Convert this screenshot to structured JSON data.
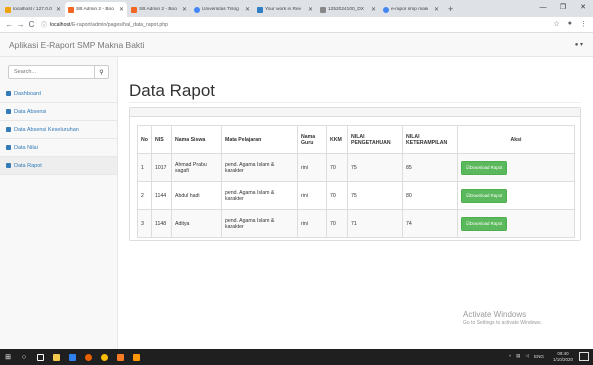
{
  "browser": {
    "tabs": [
      {
        "label": "localhost / 127.0.0",
        "color": "#f0a30a",
        "active": false
      },
      {
        "label": "SB Admin 2 - Boo",
        "color": "#f26522",
        "active": true
      },
      {
        "label": "SB Admin 2 - Boo",
        "color": "#f26522",
        "active": false
      },
      {
        "label": "Universitas Trilog",
        "color": "#4285f4",
        "active": false
      },
      {
        "label": "Your work in Rev",
        "color": "#2f7dc3",
        "active": false
      },
      {
        "label": "1252024100_DX",
        "color": "#888888",
        "active": false
      },
      {
        "label": "e-rapor smp maki",
        "color": "#4285f4",
        "active": false
      }
    ],
    "new_tab": "+",
    "url_host": "localhost",
    "url_path": "/E-raport/admin/pages/hal_data_rapot.php"
  },
  "app": {
    "brand": "Aplikasi E-Raport SMP Makna Bakti",
    "user_menu": "▾"
  },
  "sidebar": {
    "search_placeholder": "Search...",
    "items": [
      {
        "label": "Dashboard"
      },
      {
        "label": "Data Absensi"
      },
      {
        "label": "Data Absensi Keseluruhan"
      },
      {
        "label": "Data Nilai"
      },
      {
        "label": "Data Rapot"
      }
    ]
  },
  "main": {
    "title": "Data Rapot",
    "table": {
      "headers": {
        "no": "No",
        "nis": "NIS",
        "nama": "Nama Siswa",
        "mapel": "Mata Pelajaran",
        "guru": "Nama Guru",
        "kkm": "KKM",
        "pengetahuan": "NILAI PENGETAHUAN",
        "keterampilan": "NILAI KETERAMPILAN",
        "aksi": "Aksi"
      },
      "rows": [
        {
          "no": "1",
          "nis": "1017",
          "nama": "Ahmad Prabu sagafi",
          "mapel": "pend. Agama Islam & karakter",
          "guru": "rini",
          "kkm": "70",
          "pengetahuan": "75",
          "keterampilan": "85",
          "action": "☑Download Rapot"
        },
        {
          "no": "2",
          "nis": "1144",
          "nama": "Abdul hadi",
          "mapel": "pend. Agama Islam & karakter",
          "guru": "rini",
          "kkm": "70",
          "pengetahuan": "75",
          "keterampilan": "80",
          "action": "☑Download Rapot"
        },
        {
          "no": "3",
          "nis": "1148",
          "nama": "Aditya",
          "mapel": "pend. Agama Islam & karakter",
          "guru": "rini",
          "kkm": "70",
          "pengetahuan": "71",
          "keterampilan": "74",
          "action": "☑Download Rapot"
        }
      ]
    }
  },
  "watermark": {
    "line1": "Activate Windows",
    "line2": "Go to Settings to activate Windows."
  },
  "taskbar": {
    "lang": "ENG",
    "time": "09:40",
    "date": "1/10/2020"
  }
}
